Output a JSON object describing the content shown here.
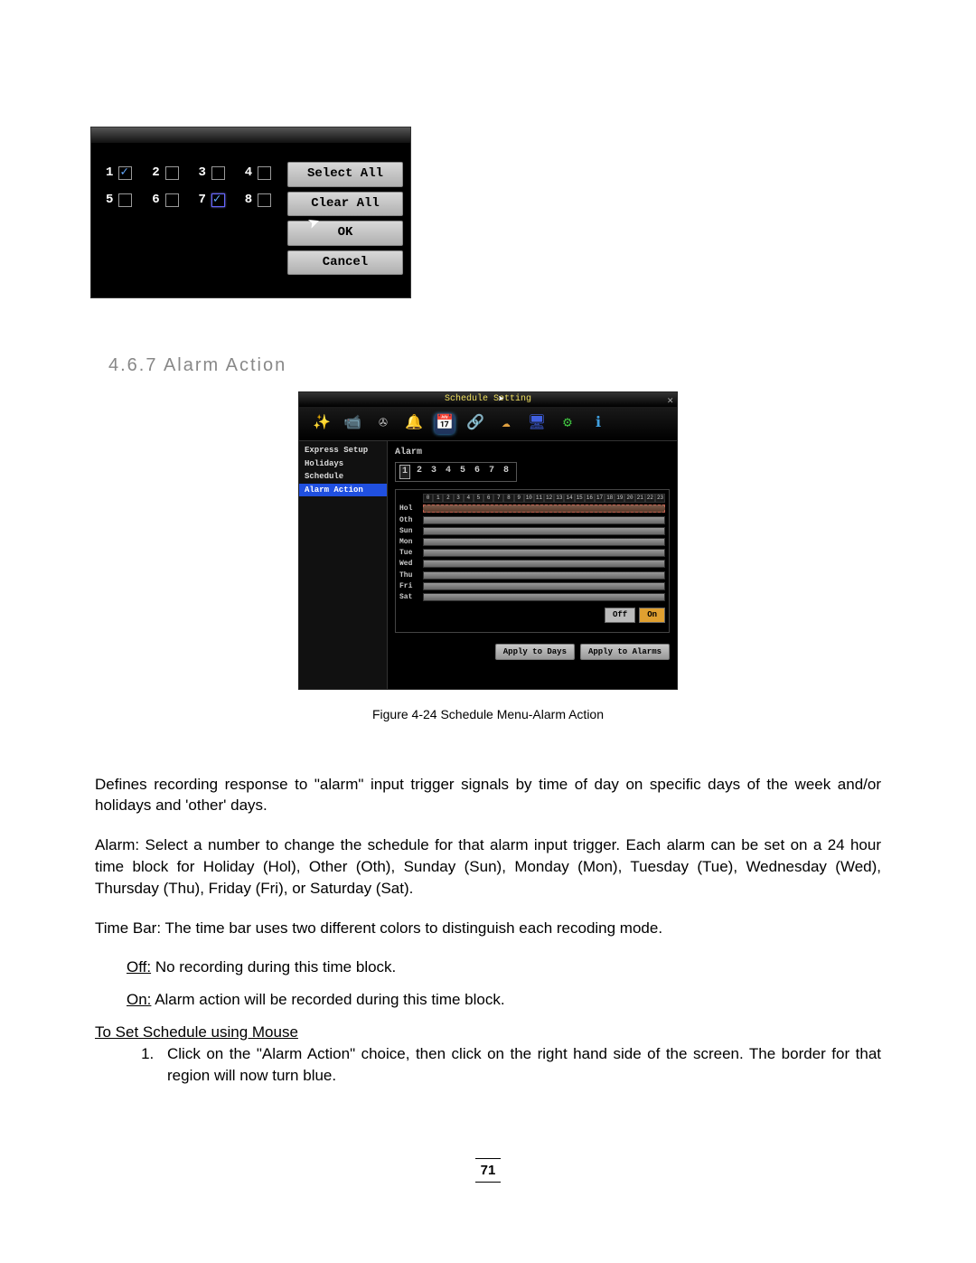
{
  "ss1": {
    "checks": [
      {
        "n": "1",
        "checked": true,
        "hl": false
      },
      {
        "n": "2",
        "checked": false,
        "hl": false
      },
      {
        "n": "3",
        "checked": false,
        "hl": false
      },
      {
        "n": "4",
        "checked": false,
        "hl": false
      },
      {
        "n": "5",
        "checked": false,
        "hl": false
      },
      {
        "n": "6",
        "checked": false,
        "hl": false
      },
      {
        "n": "7",
        "checked": true,
        "hl": true
      },
      {
        "n": "8",
        "checked": false,
        "hl": false
      }
    ],
    "btn_select_all": "Select All",
    "btn_clear_all": "Clear All",
    "btn_ok": "OK",
    "btn_cancel": "Cancel"
  },
  "section_number": "4.6.7",
  "section_title": "Alarm Action",
  "ss2": {
    "title": "Schedule Setting",
    "toolbar_icons": [
      {
        "name": "wand-icon",
        "glyph": "✨",
        "color": "#c8a850"
      },
      {
        "name": "camera-icon",
        "glyph": "📹",
        "color": "#bbb"
      },
      {
        "name": "reel-icon",
        "glyph": "✇",
        "color": "#ccc"
      },
      {
        "name": "bell-icon",
        "glyph": "🔔",
        "color": "#e8a830"
      },
      {
        "name": "schedule-icon",
        "glyph": "📅",
        "color": "#40b060",
        "selected": true
      },
      {
        "name": "network-icon",
        "glyph": "🔗",
        "color": "#40b0e8"
      },
      {
        "name": "storage-icon",
        "glyph": "☁",
        "color": "#e0a040"
      },
      {
        "name": "display-icon",
        "glyph": "🖥",
        "color": "#4060e0"
      },
      {
        "name": "settings-icon",
        "glyph": "⚙",
        "color": "#40c040"
      },
      {
        "name": "info-icon",
        "glyph": "ℹ",
        "color": "#40a0e0"
      }
    ],
    "sidebar": [
      {
        "label": "Express Setup",
        "active": false
      },
      {
        "label": "Holidays",
        "active": false
      },
      {
        "label": "Schedule",
        "active": false
      },
      {
        "label": "Alarm Action",
        "active": true
      }
    ],
    "alarm_label": "Alarm",
    "alarm_tabs": [
      "1",
      "2",
      "3",
      "4",
      "5",
      "6",
      "7",
      "8"
    ],
    "alarm_selected": "1",
    "hours": [
      "0",
      "1",
      "2",
      "3",
      "4",
      "5",
      "6",
      "7",
      "8",
      "9",
      "10",
      "11",
      "12",
      "13",
      "14",
      "15",
      "16",
      "17",
      "18",
      "19",
      "20",
      "21",
      "22",
      "23"
    ],
    "days": [
      {
        "lbl": "Hol",
        "hol": true
      },
      {
        "lbl": "Oth",
        "hol": false
      },
      {
        "lbl": "Sun",
        "hol": false
      },
      {
        "lbl": "Mon",
        "hol": false
      },
      {
        "lbl": "Tue",
        "hol": false
      },
      {
        "lbl": "Wed",
        "hol": false
      },
      {
        "lbl": "Thu",
        "hol": false
      },
      {
        "lbl": "Fri",
        "hol": false
      },
      {
        "lbl": "Sat",
        "hol": false
      }
    ],
    "key_off": "Off",
    "key_on": "On",
    "btn_apply_days": "Apply to Days",
    "btn_apply_alarms": "Apply to Alarms"
  },
  "caption": "Figure 4-24 Schedule Menu-Alarm Action",
  "para1": "Defines recording response to \"alarm\" input trigger signals by time of day on specific days of the week and/or holidays and 'other' days.",
  "para2_lead": "Alarm:",
  "para2_body": " Select a number to change the schedule for that alarm input trigger. Each alarm can be set on a 24 hour time block for Holiday (Hol), Other (Oth), Sunday (Sun), Monday (Mon), Tuesday (Tue), Wednesday (Wed), Thursday (Thu), Friday (Fri), or Saturday (Sat).",
  "para3_lead": "Time Bar:",
  "para3_body": " The time bar uses two different colors to distinguish each recoding mode.",
  "off_lead": "Off:",
  "off_body": " No recording during this time block.",
  "on_lead": "On:",
  "on_body": " Alarm action will be recorded during this time block.",
  "mouse_head": "To Set Schedule using Mouse",
  "step1": "Click on the \"Alarm Action\" choice, then click on the right hand side of the screen. The border for that region will now turn blue.",
  "page": "71"
}
